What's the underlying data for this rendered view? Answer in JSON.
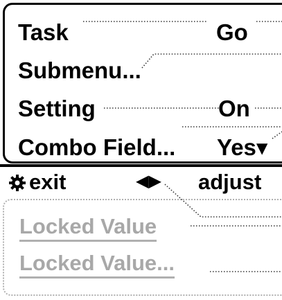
{
  "menu": {
    "rows": [
      {
        "label": "Task",
        "value": "Go"
      },
      {
        "label": "Submenu...",
        "value": ""
      },
      {
        "label": "Setting",
        "value": "On"
      },
      {
        "label": "Combo Field...",
        "value": "Yes▾"
      }
    ]
  },
  "footer": {
    "exit_icon": "gear-icon",
    "exit_label": "exit",
    "arrows": "◀▶",
    "adjust_label": "adjust"
  },
  "locked": {
    "items": [
      "Locked Value",
      "Locked Value..."
    ]
  },
  "colors": {
    "frame": "#000000",
    "locked_text": "#a8a8a8",
    "dotted_leader": "#333333"
  }
}
